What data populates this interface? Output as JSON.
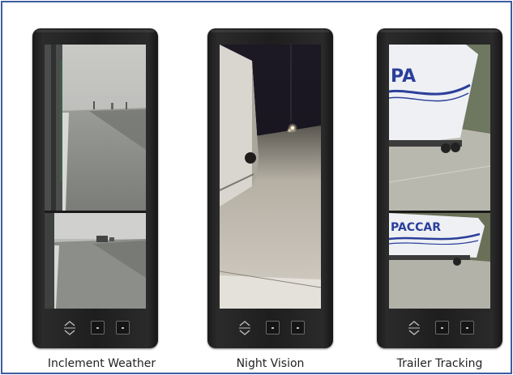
{
  "captions": {
    "monitor_1": "Inclement Weather",
    "monitor_2": "Night Vision",
    "monitor_3": "Trailer Tracking"
  },
  "trailer_lettering": "PACCAR",
  "colors": {
    "frame_border": "#3f5ca0",
    "trailer_stripe": "#2b3f9a"
  },
  "icons": [
    "up-down-arrows-icon",
    "button-icon"
  ]
}
